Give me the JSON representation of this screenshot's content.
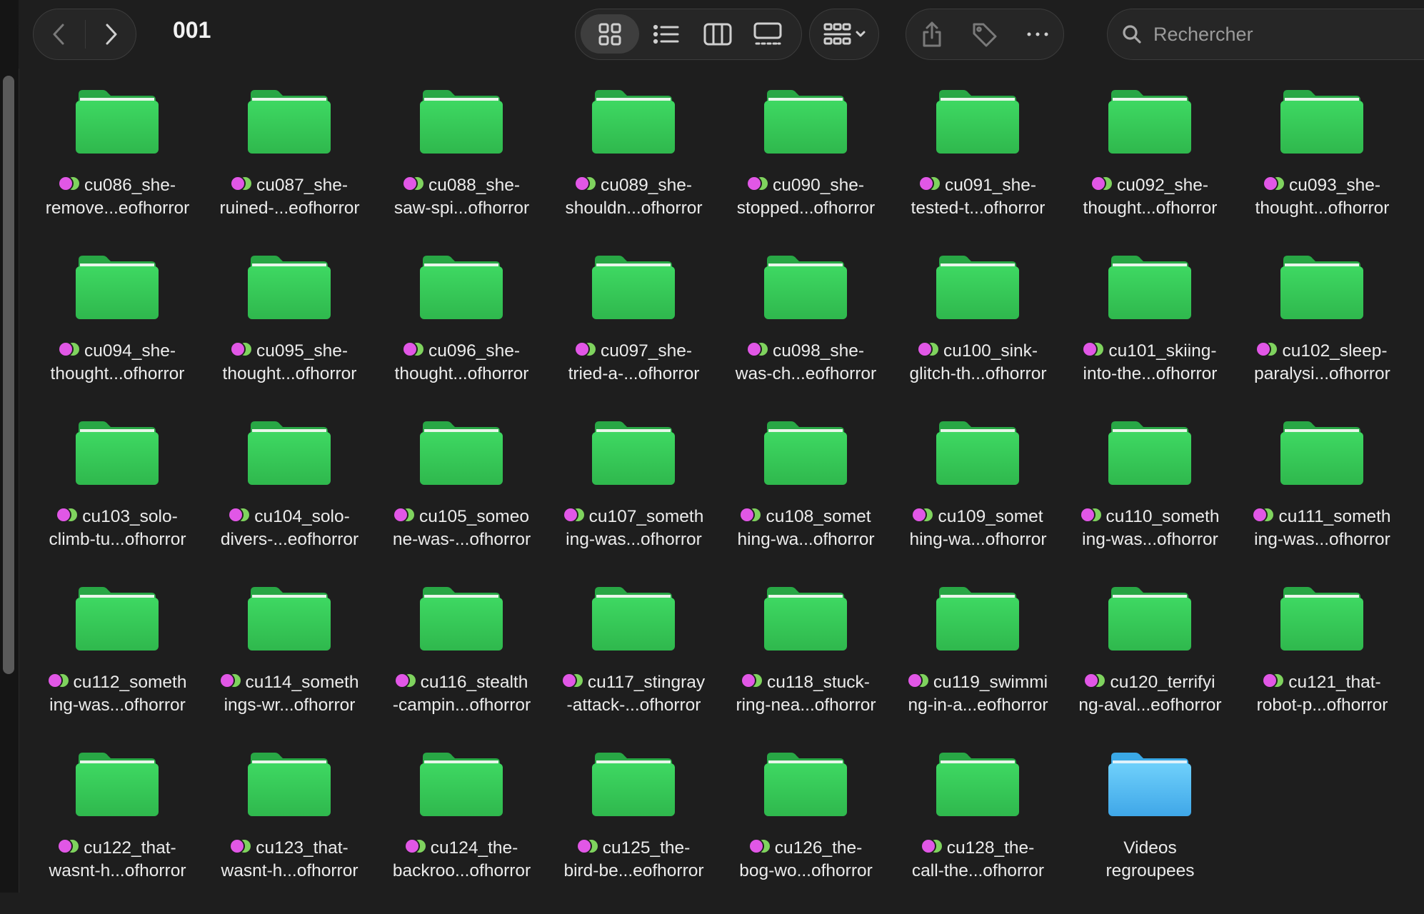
{
  "window": {
    "title": "001"
  },
  "toolbar": {
    "nav": {
      "back_icon": "chevron-left-icon",
      "forward_icon": "chevron-right-icon"
    },
    "views": [
      {
        "name": "icon-view",
        "icon": "grid-icon",
        "active": true
      },
      {
        "name": "list-view",
        "icon": "list-icon",
        "active": false
      },
      {
        "name": "column-view",
        "icon": "columns-icon",
        "active": false
      },
      {
        "name": "gallery-view",
        "icon": "gallery-icon",
        "active": false
      }
    ],
    "group_icon": "group-grid-icon",
    "actions": [
      "share-icon",
      "tag-icon",
      "more-icon"
    ],
    "search": {
      "placeholder": "Rechercher"
    }
  },
  "tag_colors": {
    "purple": "#e157e6",
    "green": "#7fd35e"
  },
  "folder_colors": {
    "green": "#34c759",
    "blue": "#5ac8fa"
  },
  "items": [
    {
      "line1": "cu086_she-",
      "line2": "remove...eofhorror",
      "color": "green",
      "tagged": true
    },
    {
      "line1": "cu087_she-",
      "line2": "ruined-...eofhorror",
      "color": "green",
      "tagged": true
    },
    {
      "line1": "cu088_she-",
      "line2": "saw-spi...ofhorror",
      "color": "green",
      "tagged": true
    },
    {
      "line1": "cu089_she-",
      "line2": "shouldn...ofhorror",
      "color": "green",
      "tagged": true
    },
    {
      "line1": "cu090_she-",
      "line2": "stopped...ofhorror",
      "color": "green",
      "tagged": true
    },
    {
      "line1": "cu091_she-",
      "line2": "tested-t...ofhorror",
      "color": "green",
      "tagged": true
    },
    {
      "line1": "cu092_she-",
      "line2": "thought...ofhorror",
      "color": "green",
      "tagged": true
    },
    {
      "line1": "cu093_she-",
      "line2": "thought...ofhorror",
      "color": "green",
      "tagged": true
    },
    {
      "line1": "cu094_she-",
      "line2": "thought...ofhorror",
      "color": "green",
      "tagged": true
    },
    {
      "line1": "cu095_she-",
      "line2": "thought...ofhorror",
      "color": "green",
      "tagged": true
    },
    {
      "line1": "cu096_she-",
      "line2": "thought...ofhorror",
      "color": "green",
      "tagged": true
    },
    {
      "line1": "cu097_she-",
      "line2": "tried-a-...ofhorror",
      "color": "green",
      "tagged": true
    },
    {
      "line1": "cu098_she-",
      "line2": "was-ch...eofhorror",
      "color": "green",
      "tagged": true
    },
    {
      "line1": "cu100_sink-",
      "line2": "glitch-th...ofhorror",
      "color": "green",
      "tagged": true
    },
    {
      "line1": "cu101_skiing-",
      "line2": "into-the...ofhorror",
      "color": "green",
      "tagged": true
    },
    {
      "line1": "cu102_sleep-",
      "line2": "paralysi...ofhorror",
      "color": "green",
      "tagged": true
    },
    {
      "line1": "cu103_solo-",
      "line2": "climb-tu...ofhorror",
      "color": "green",
      "tagged": true
    },
    {
      "line1": "cu104_solo-",
      "line2": "divers-...eofhorror",
      "color": "green",
      "tagged": true
    },
    {
      "line1": "cu105_someo",
      "line2": "ne-was-...ofhorror",
      "color": "green",
      "tagged": true
    },
    {
      "line1": "cu107_someth",
      "line2": "ing-was...ofhorror",
      "color": "green",
      "tagged": true
    },
    {
      "line1": "cu108_somet",
      "line2": "hing-wa...ofhorror",
      "color": "green",
      "tagged": true
    },
    {
      "line1": "cu109_somet",
      "line2": "hing-wa...ofhorror",
      "color": "green",
      "tagged": true
    },
    {
      "line1": "cu110_someth",
      "line2": "ing-was...ofhorror",
      "color": "green",
      "tagged": true
    },
    {
      "line1": "cu111_someth",
      "line2": "ing-was...ofhorror",
      "color": "green",
      "tagged": true
    },
    {
      "line1": "cu112_someth",
      "line2": "ing-was...ofhorror",
      "color": "green",
      "tagged": true
    },
    {
      "line1": "cu114_someth",
      "line2": "ings-wr...ofhorror",
      "color": "green",
      "tagged": true
    },
    {
      "line1": "cu116_stealth",
      "line2": "-campin...ofhorror",
      "color": "green",
      "tagged": true
    },
    {
      "line1": "cu117_stingray",
      "line2": "-attack-...ofhorror",
      "color": "green",
      "tagged": true
    },
    {
      "line1": "cu118_stuck-",
      "line2": "ring-nea...ofhorror",
      "color": "green",
      "tagged": true
    },
    {
      "line1": "cu119_swimmi",
      "line2": "ng-in-a...eofhorror",
      "color": "green",
      "tagged": true
    },
    {
      "line1": "cu120_terrifyi",
      "line2": "ng-aval...eofhorror",
      "color": "green",
      "tagged": true
    },
    {
      "line1": "cu121_that-",
      "line2": "robot-p...ofhorror",
      "color": "green",
      "tagged": true
    },
    {
      "line1": "cu122_that-",
      "line2": "wasnt-h...ofhorror",
      "color": "green",
      "tagged": true
    },
    {
      "line1": "cu123_that-",
      "line2": "wasnt-h...ofhorror",
      "color": "green",
      "tagged": true
    },
    {
      "line1": "cu124_the-",
      "line2": "backroo...ofhorror",
      "color": "green",
      "tagged": true
    },
    {
      "line1": "cu125_the-",
      "line2": "bird-be...eofhorror",
      "color": "green",
      "tagged": true
    },
    {
      "line1": "cu126_the-",
      "line2": "bog-wo...ofhorror",
      "color": "green",
      "tagged": true
    },
    {
      "line1": "cu128_the-",
      "line2": "call-the...ofhorror",
      "color": "green",
      "tagged": true
    },
    {
      "line1": "Videos",
      "line2": "regroupees",
      "color": "blue",
      "tagged": false
    }
  ]
}
